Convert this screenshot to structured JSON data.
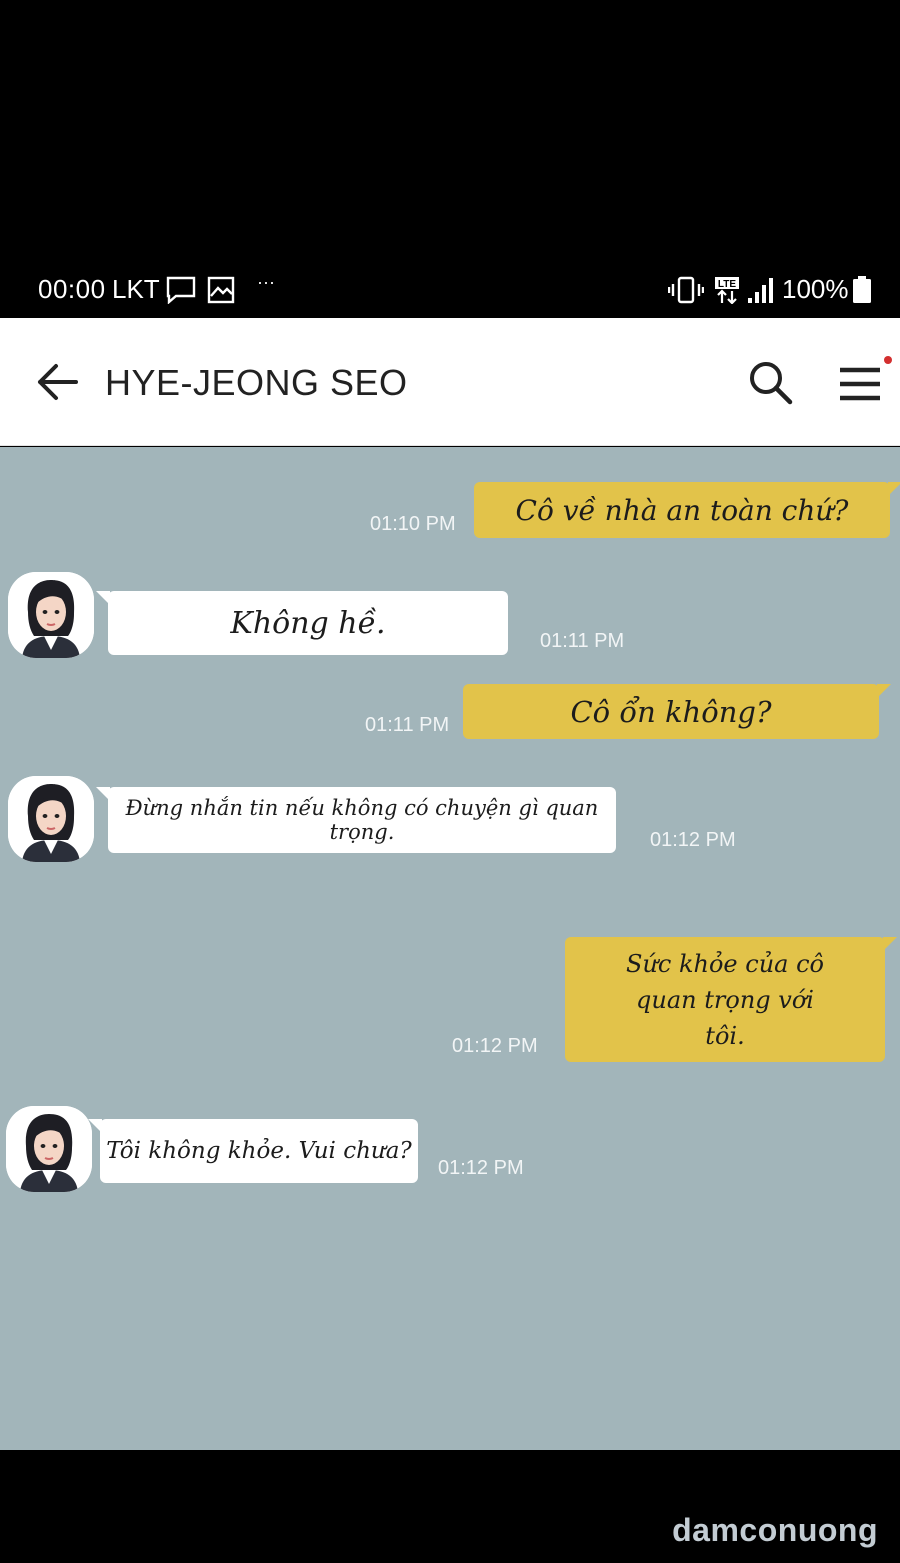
{
  "status_bar": {
    "time": "00:00",
    "carrier": "LKT",
    "dots": "···",
    "battery": "100%",
    "icons": [
      "message-icon",
      "image-icon",
      "vibrate-icon",
      "lte-icon",
      "signal-icon",
      "battery-icon"
    ]
  },
  "header": {
    "title": "HYE-JEONG SEO",
    "icons": [
      "back-arrow-icon",
      "search-icon",
      "menu-icon"
    ],
    "notification_dot_color": "#d32f2f"
  },
  "colors": {
    "chat_background": "#a2b5ba",
    "outgoing_bubble": "#e2c34a",
    "incoming_bubble": "#ffffff"
  },
  "messages": [
    {
      "direction": "out",
      "text": "Cô về nhà an toàn chứ?",
      "time": "01:10 PM"
    },
    {
      "direction": "in",
      "text": "Không hề.",
      "time": "01:11 PM"
    },
    {
      "direction": "out",
      "text": "Cô ổn không?",
      "time": "01:11 PM"
    },
    {
      "direction": "in",
      "text": "Đừng nhắn tin nếu không có chuyện gì quan trọng.",
      "time": "01:12 PM"
    },
    {
      "direction": "out",
      "text": "Sức khỏe của cô quan trọng với tôi.",
      "time": "01:12 PM"
    },
    {
      "direction": "in",
      "text": "Tôi không khỏe. Vui chưa?",
      "time": "01:12 PM"
    }
  ],
  "watermark": "damconuong"
}
